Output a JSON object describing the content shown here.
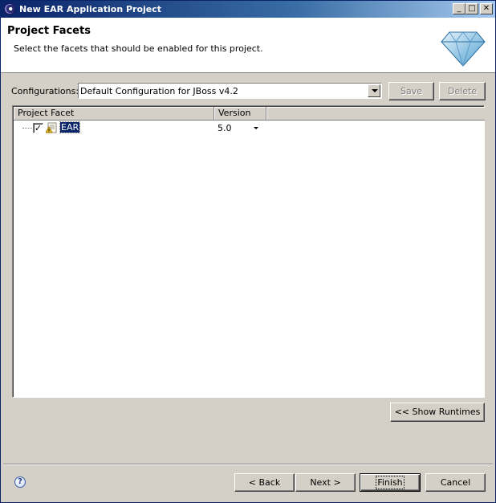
{
  "window": {
    "title": "New EAR Application Project"
  },
  "banner": {
    "title": "Project Facets",
    "description": "Select the facets that should be enabled for this project."
  },
  "configurations": {
    "label": "Configurations:",
    "selected": "Default Configuration for JBoss v4.2",
    "save_label": "Save",
    "delete_label": "Delete"
  },
  "table": {
    "columns": [
      "Project Facet",
      "Version"
    ],
    "rows": [
      {
        "facet": "EAR",
        "version": "5.0",
        "checked": true
      }
    ]
  },
  "buttons": {
    "show_runtimes": "<< Show Runtimes",
    "back": "< Back",
    "next": "Next >",
    "finish": "Finish",
    "cancel": "Cancel"
  },
  "icons": {
    "app": "eclipse-icon",
    "banner": "diamond-icon",
    "facet": "ear-facet-icon",
    "help": "help-icon"
  }
}
